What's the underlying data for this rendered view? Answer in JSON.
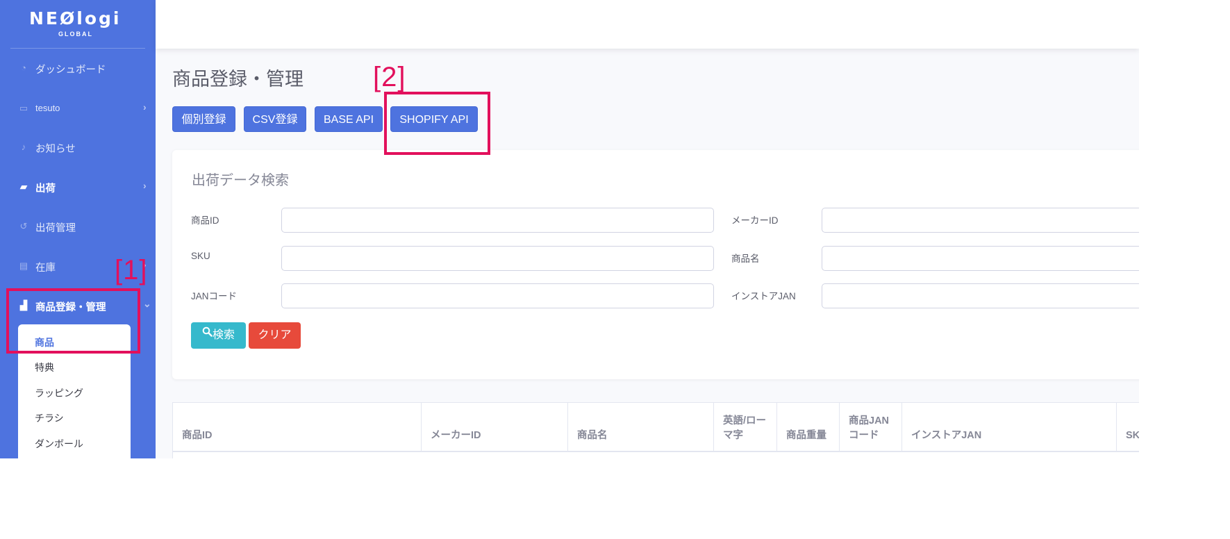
{
  "brand": {
    "logo": "NEØlogi",
    "sub": "GLOBAL"
  },
  "sidebar": {
    "items": [
      {
        "label": "ダッシュボード",
        "icon": "tachometer-icon"
      },
      {
        "label": "tesuto",
        "icon": "drawer-icon"
      },
      {
        "label": "お知らせ",
        "icon": "bell-icon"
      },
      {
        "label": "出荷",
        "icon": "truck-icon"
      },
      {
        "label": "出荷管理",
        "icon": "history-icon"
      },
      {
        "label": "在庫",
        "icon": "warehouse-icon"
      },
      {
        "label": "商品登録・管理",
        "icon": "boxes-icon"
      }
    ],
    "submenu": [
      "商品",
      "特典",
      "ラッピング",
      "チラシ",
      "ダンボール"
    ]
  },
  "page": {
    "title": "商品登録・管理",
    "buttons": [
      "個別登録",
      "CSV登録",
      "BASE API",
      "SHOPIFY API"
    ]
  },
  "search": {
    "title": "出荷データ検索",
    "fields": {
      "product_id": "商品ID",
      "sku": "SKU",
      "jan_code": "JANコード",
      "maker_id": "メーカーID",
      "product_name": "商品名",
      "instore_jan": "インストアJAN"
    },
    "search_button": "検索",
    "clear_button": "クリア"
  },
  "table": {
    "headers": [
      "商品ID",
      "メーカーID",
      "商品名",
      "英語/ロー\nマ字",
      "商品重量",
      "商品JAN\nコード",
      "インストアJAN",
      "SKU"
    ]
  },
  "annotations": {
    "mark1": "[1]",
    "mark2": "[2]",
    "color": "#e2105c"
  },
  "colors": {
    "primary": "#4e73df",
    "info": "#36b9cc",
    "danger": "#e74a3b"
  }
}
